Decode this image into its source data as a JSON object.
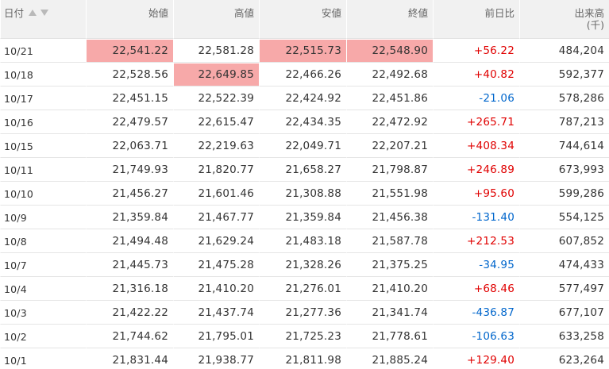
{
  "headers": {
    "date": "日付",
    "open": "始値",
    "high": "高値",
    "low": "安値",
    "close": "終値",
    "change": "前日比",
    "volume": "出来高",
    "volume_unit": "(千)"
  },
  "colors": {
    "highlight": "#f7a9a9",
    "up": "#e00000",
    "down": "#0066cc"
  },
  "rows": [
    {
      "date": "10/21",
      "open": "22,541.22",
      "high": "22,581.28",
      "low": "22,515.73",
      "close": "22,548.90",
      "change": "+56.22",
      "volume": "484,204"
    },
    {
      "date": "10/18",
      "open": "22,528.56",
      "high": "22,649.85",
      "low": "22,466.26",
      "close": "22,492.68",
      "change": "+40.82",
      "volume": "592,377"
    },
    {
      "date": "10/17",
      "open": "22,451.15",
      "high": "22,522.39",
      "low": "22,424.92",
      "close": "22,451.86",
      "change": "-21.06",
      "volume": "578,286"
    },
    {
      "date": "10/16",
      "open": "22,479.57",
      "high": "22,615.47",
      "low": "22,434.35",
      "close": "22,472.92",
      "change": "+265.71",
      "volume": "787,213"
    },
    {
      "date": "10/15",
      "open": "22,063.71",
      "high": "22,219.63",
      "low": "22,049.71",
      "close": "22,207.21",
      "change": "+408.34",
      "volume": "744,614"
    },
    {
      "date": "10/11",
      "open": "21,749.93",
      "high": "21,820.77",
      "low": "21,658.27",
      "close": "21,798.87",
      "change": "+246.89",
      "volume": "673,993"
    },
    {
      "date": "10/10",
      "open": "21,456.27",
      "high": "21,601.46",
      "low": "21,308.88",
      "close": "21,551.98",
      "change": "+95.60",
      "volume": "599,286"
    },
    {
      "date": "10/9",
      "open": "21,359.84",
      "high": "21,467.77",
      "low": "21,359.84",
      "close": "21,456.38",
      "change": "-131.40",
      "volume": "554,125"
    },
    {
      "date": "10/8",
      "open": "21,494.48",
      "high": "21,629.24",
      "low": "21,483.18",
      "close": "21,587.78",
      "change": "+212.53",
      "volume": "607,852"
    },
    {
      "date": "10/7",
      "open": "21,445.73",
      "high": "21,475.28",
      "low": "21,328.26",
      "close": "21,375.25",
      "change": "-34.95",
      "volume": "474,433"
    },
    {
      "date": "10/4",
      "open": "21,316.18",
      "high": "21,410.20",
      "low": "21,276.01",
      "close": "21,410.20",
      "change": "+68.46",
      "volume": "577,497"
    },
    {
      "date": "10/3",
      "open": "21,422.22",
      "high": "21,437.74",
      "low": "21,277.36",
      "close": "21,341.74",
      "change": "-436.87",
      "volume": "677,107"
    },
    {
      "date": "10/2",
      "open": "21,744.62",
      "high": "21,795.01",
      "low": "21,725.23",
      "close": "21,778.61",
      "change": "-106.63",
      "volume": "633,258"
    },
    {
      "date": "10/1",
      "open": "21,831.44",
      "high": "21,938.77",
      "low": "21,811.98",
      "close": "21,885.24",
      "change": "+129.40",
      "volume": "623,264"
    }
  ]
}
